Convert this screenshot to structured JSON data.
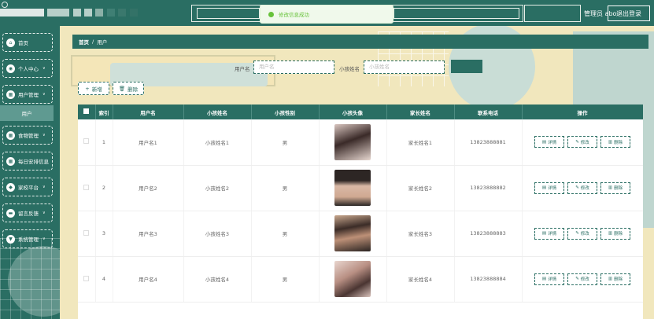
{
  "header": {
    "admin": "管理员 abo",
    "logout": "退出登录"
  },
  "toast": {
    "message": "修改信息成功"
  },
  "sidebar": {
    "items": [
      {
        "label": "首页",
        "icon": "home-icon",
        "glyph": "⌂"
      },
      {
        "label": "个人中心",
        "icon": "user-icon",
        "glyph": "◉"
      },
      {
        "label": "用户管理",
        "icon": "users-icon",
        "glyph": "▦"
      },
      {
        "label": "用户",
        "icon": "",
        "glyph": ""
      },
      {
        "label": "食物管理",
        "icon": "food-icon",
        "glyph": "▦"
      },
      {
        "label": "每日安排信息",
        "icon": "schedule-icon",
        "glyph": "▦"
      },
      {
        "label": "家校平台",
        "icon": "platform-icon",
        "glyph": "◆"
      },
      {
        "label": "留言反馈",
        "icon": "message-icon",
        "glyph": "▬"
      },
      {
        "label": "系统管理",
        "icon": "settings-icon",
        "glyph": "▼"
      }
    ]
  },
  "breadcrumb": {
    "home": "首页",
    "sep": "/",
    "current": "用户"
  },
  "search": {
    "username_label": "用户名",
    "username_placeholder": "用户名",
    "childname_label": "小孩姓名",
    "childname_placeholder": "小孩姓名"
  },
  "actions": {
    "add": "新增",
    "delete": "删除"
  },
  "table": {
    "headers": [
      "索引",
      "用户名",
      "小孩姓名",
      "小孩性别",
      "小孩头像",
      "家长姓名",
      "联系电话",
      "操作"
    ],
    "rows": [
      {
        "index": "1",
        "username": "用户名1",
        "child": "小孩姓名1",
        "gender": "男",
        "parent": "家长姓名1",
        "phone": "13823888881"
      },
      {
        "index": "2",
        "username": "用户名2",
        "child": "小孩姓名2",
        "gender": "男",
        "parent": "家长姓名2",
        "phone": "13823888882"
      },
      {
        "index": "3",
        "username": "用户名3",
        "child": "小孩姓名3",
        "gender": "男",
        "parent": "家长姓名3",
        "phone": "13823888883"
      },
      {
        "index": "4",
        "username": "用户名4",
        "child": "小孩姓名4",
        "gender": "男",
        "parent": "家长姓名4",
        "phone": "13823888884"
      }
    ],
    "row_buttons": {
      "detail": "详情",
      "edit": "修改",
      "delete": "删除"
    }
  },
  "colors": {
    "primary": "#2a6e63",
    "background": "#f1e7bd",
    "success": "#67c23a"
  }
}
